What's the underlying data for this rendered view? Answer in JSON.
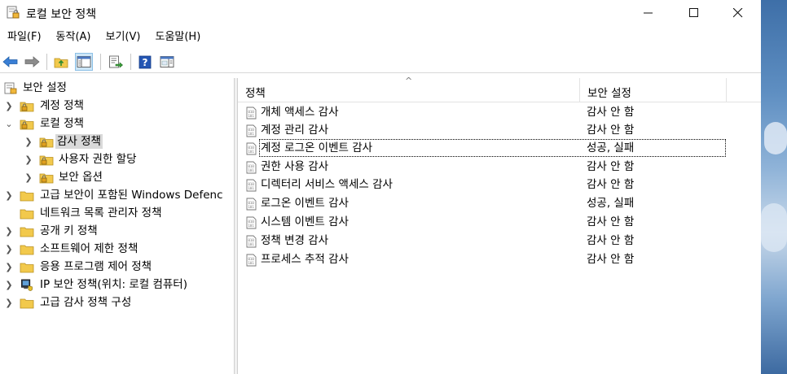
{
  "window": {
    "title": "로컬 보안 정책",
    "controls": {
      "minimize": "—",
      "maximize": "☐",
      "close": "✕"
    }
  },
  "menu": [
    "파일(F)",
    "동작(A)",
    "보기(V)",
    "도움말(H)"
  ],
  "toolbar": {
    "icons": [
      "back-arrow-icon",
      "forward-arrow-icon",
      "up-folder-icon",
      "show-hide-tree-icon",
      "export-list-icon",
      "help-icon",
      "properties-view-icon"
    ]
  },
  "tree": {
    "root": "보안 설정",
    "items": [
      {
        "label": "계정 정책",
        "level": 1,
        "expanded": false,
        "icon": "folder-lock-icon"
      },
      {
        "label": "로컬 정책",
        "level": 1,
        "expanded": true,
        "icon": "folder-lock-icon"
      },
      {
        "label": "감사 정책",
        "level": 2,
        "expanded": false,
        "icon": "folder-lock-icon",
        "selected": true
      },
      {
        "label": "사용자 권한 할당",
        "level": 2,
        "expanded": false,
        "icon": "folder-lock-icon"
      },
      {
        "label": "보안 옵션",
        "level": 2,
        "expanded": false,
        "icon": "folder-lock-icon"
      },
      {
        "label": "고급 보안이 포함된 Windows Defenc",
        "level": 1,
        "expanded": false,
        "icon": "folder-icon"
      },
      {
        "label": "네트워크 목록 관리자 정책",
        "level": 1,
        "expanded": null,
        "icon": "folder-icon"
      },
      {
        "label": "공개 키 정책",
        "level": 1,
        "expanded": false,
        "icon": "folder-icon"
      },
      {
        "label": "소프트웨어 제한 정책",
        "level": 1,
        "expanded": false,
        "icon": "folder-icon"
      },
      {
        "label": "응용 프로그램 제어 정책",
        "level": 1,
        "expanded": false,
        "icon": "folder-icon"
      },
      {
        "label": "IP 보안 정책(위치: 로컬 컴퓨터)",
        "level": 1,
        "expanded": false,
        "icon": "ip-security-icon"
      },
      {
        "label": "고급 감사 정책 구성",
        "level": 1,
        "expanded": false,
        "icon": "folder-icon"
      }
    ]
  },
  "list": {
    "columns": [
      "정책",
      "보안 설정"
    ],
    "sort_indicator": "^",
    "rows": [
      {
        "policy": "개체 액세스 감사",
        "setting": "감사 안 함"
      },
      {
        "policy": "계정 관리 감사",
        "setting": "감사 안 함"
      },
      {
        "policy": "계정 로그온 이벤트 감사",
        "setting": "성공, 실패",
        "focused": true
      },
      {
        "policy": "권한 사용 감사",
        "setting": "감사 안 함"
      },
      {
        "policy": "디렉터리 서비스 액세스 감사",
        "setting": "감사 안 함"
      },
      {
        "policy": "로그온 이벤트 감사",
        "setting": "성공, 실패"
      },
      {
        "policy": "시스템 이벤트 감사",
        "setting": "감사 안 함"
      },
      {
        "policy": "정책 변경 감사",
        "setting": "감사 안 함"
      },
      {
        "policy": "프로세스 추적 감사",
        "setting": "감사 안 함"
      }
    ]
  },
  "colors": {
    "selection": "#d9d9d9",
    "toolbar_active": "#cde6f7",
    "folder": "#f2c94c",
    "back_arrow": "#3a7fd5"
  }
}
